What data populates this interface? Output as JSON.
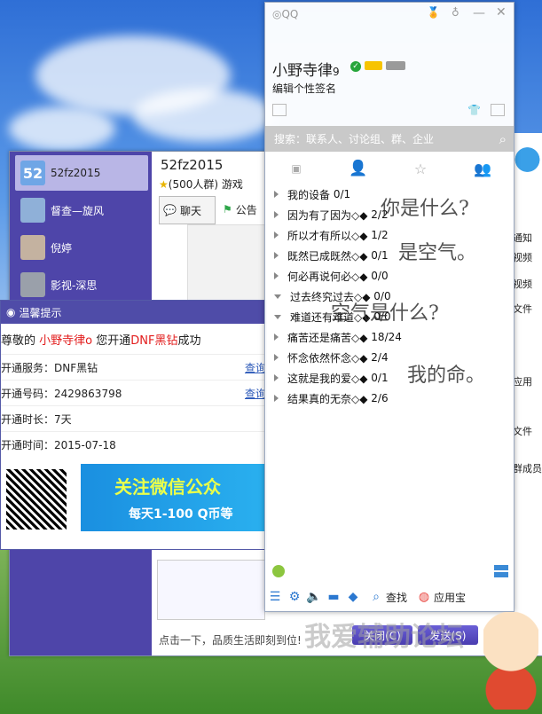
{
  "chat": {
    "contacts": [
      {
        "name": "52fz2015",
        "badge": "52"
      },
      {
        "name": "督查—旋风"
      },
      {
        "name": "倪婷"
      },
      {
        "name": "影视-深思"
      }
    ],
    "group_name": "52fz2015",
    "group_info": "(500人群) 游戏",
    "tabs": [
      "聊天",
      "公告"
    ],
    "bottom_hint": "点击一下，品质生活即刻到位!",
    "close_label": "关闭(C)",
    "send_label": "发送(S)",
    "watermark": "我爱辅助论坛"
  },
  "notice": {
    "title": "温馨提示",
    "greeting_prefix": "尊敬的",
    "user": "小野寺律",
    "greeting_mid": "您开通",
    "product": "DNF黑钻",
    "greeting_suffix": "成功",
    "rows": [
      {
        "label": "开通服务：DNF黑钻",
        "link": "查询"
      },
      {
        "label": "开通号码：2429863798",
        "link": "查询"
      },
      {
        "label": "开通时长：7天",
        "link": ""
      },
      {
        "label": "开通时间：2015-07-18",
        "link": ""
      }
    ],
    "banner_title": "关注微信公众",
    "banner_sub": "每天1-100 Q币等"
  },
  "qq": {
    "nickname": "小野寺律",
    "signature": "编辑个性签名",
    "search_placeholder": "搜索：联系人、讨论组、群、企业",
    "groups": [
      {
        "name": "我的设备",
        "count": "0/1",
        "open": false
      },
      {
        "name": "因为有了因为◇◆",
        "count": "2/2",
        "open": false
      },
      {
        "name": "所以才有所以◇◆",
        "count": "1/2",
        "open": false
      },
      {
        "name": "既然已成既然◇◆",
        "count": "0/1",
        "open": false
      },
      {
        "name": "何必再说何必◇◆",
        "count": "0/0",
        "open": false
      },
      {
        "name": "过去终究过去◇◆",
        "count": "0/0",
        "open": true
      },
      {
        "name": "难道还有难道◇◆",
        "count": "0/0",
        "open": true
      },
      {
        "name": "痛苦还是痛苦◇◆",
        "count": "18/24",
        "open": false
      },
      {
        "name": "怀念依然怀念◇◆",
        "count": "2/4",
        "open": false
      },
      {
        "name": "这就是我的爱◇◆",
        "count": "0/1",
        "open": false
      },
      {
        "name": "结果真的无奈◇◆",
        "count": "2/6",
        "open": false
      }
    ],
    "search_btn": "查找",
    "app_btn": "应用宝",
    "handwriting": [
      "你是什么?",
      "是空气。",
      "空气是什么?",
      "我的命。"
    ]
  },
  "right_strip": {
    "items": [
      "通知",
      "视频",
      "视频",
      "文件",
      "应用",
      "文件",
      "群成员"
    ]
  },
  "colors": {
    "accent": "#4e45a9",
    "link": "#2b58b8",
    "red": "#e21d1d",
    "vip": "#27a53b"
  }
}
